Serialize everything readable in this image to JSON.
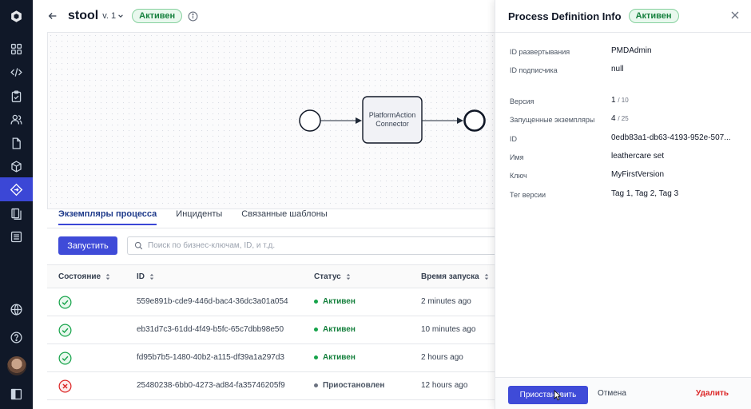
{
  "header": {
    "title": "stool",
    "version": "v. 1",
    "status": "Активен"
  },
  "diagram": {
    "task_line1": "PlatformAction",
    "task_line2": "Connector"
  },
  "tabs": [
    {
      "label": "Экземпляры процесса",
      "active": true
    },
    {
      "label": "Инциденты",
      "active": false
    },
    {
      "label": "Связанные шаблоны",
      "active": false
    }
  ],
  "toolbar": {
    "run_label": "Запустить",
    "search_placeholder": "Поиск по бизнес-ключам, ID, и т.д."
  },
  "table": {
    "columns": [
      "Состояние",
      "ID",
      "Статус",
      "Время запуска"
    ],
    "rows": [
      {
        "state": "ok",
        "id": "559e891b-cde9-446d-bac4-36dc3a01a054",
        "status": "Активен",
        "time": "2 minutes ago"
      },
      {
        "state": "ok",
        "id": "eb31d7c3-61dd-4f49-b5fc-65c7dbb98e50",
        "status": "Активен",
        "time": "10 minutes ago"
      },
      {
        "state": "ok",
        "id": "fd95b7b5-1480-40b2-a115-df39a1a297d3",
        "status": "Активен",
        "time": "2 hours ago"
      },
      {
        "state": "error",
        "id": "25480238-6bb0-4273-ad84-fa35746205f9",
        "status": "Приостановлен",
        "time": "12 hours ago"
      }
    ]
  },
  "panel": {
    "title": "Process Definition Info",
    "status": "Активен",
    "fields": {
      "deployment_label": "ID развертывания",
      "deployment_value": "PMDAdmin",
      "subscriber_label": "ID подписчика",
      "subscriber_value": "null",
      "version_label": "Версия",
      "version_value": "1",
      "version_total": "/ 10",
      "instances_label": "Запущенные экземпляры",
      "instances_value": "4",
      "instances_total": "/ 25",
      "id_label": "ID",
      "id_value": "0edb83a1-db63-4193-952e-507...",
      "name_label": "Имя",
      "name_value": "leathercare set",
      "key_label": "Ключ",
      "key_value": "MyFirstVersion",
      "tag_label": "Тег версии",
      "tag_value": "Tag 1, Tag 2, Tag 3"
    },
    "actions": {
      "suspend": "Приостановить",
      "cancel": "Отмена",
      "delete": "Удалить"
    }
  },
  "colors": {
    "accent": "#3f4bd8",
    "active_green": "#15803d",
    "error_red": "#dc2626",
    "rail": "#101828"
  },
  "icons": [
    "logo-icon",
    "grid-icon",
    "code-icon",
    "clipboard-icon",
    "users-icon",
    "file-icon",
    "cube-icon",
    "process-icon",
    "book-icon",
    "list-icon",
    "globe-icon",
    "help-icon",
    "avatar",
    "panel-toggle-icon"
  ]
}
